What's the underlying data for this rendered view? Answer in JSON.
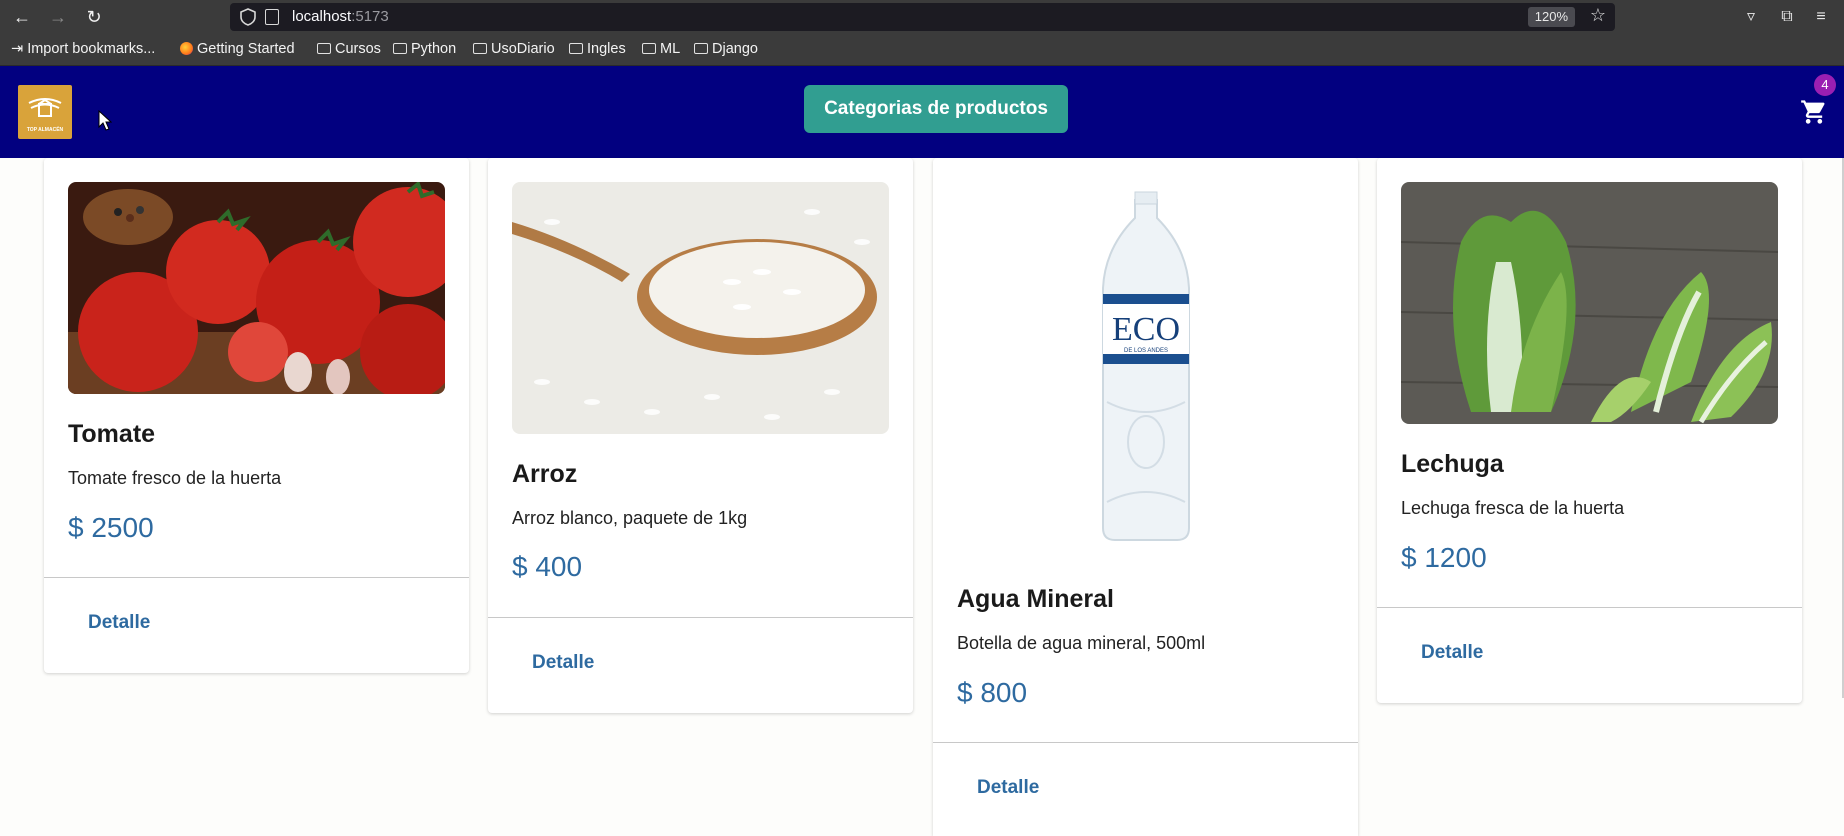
{
  "browser": {
    "url_host": "localhost",
    "url_port": ":5173",
    "zoom": "120%",
    "bookmarks": [
      {
        "label": "Import bookmarks...",
        "icon": "import-icon"
      },
      {
        "label": "Getting Started",
        "icon": "firefox-icon"
      },
      {
        "label": "Cursos",
        "icon": "folder-icon"
      },
      {
        "label": "Python",
        "icon": "folder-icon"
      },
      {
        "label": "UsoDiario",
        "icon": "folder-icon"
      },
      {
        "label": "Ingles",
        "icon": "folder-icon"
      },
      {
        "label": "ML",
        "icon": "folder-icon"
      },
      {
        "label": "Django",
        "icon": "folder-icon"
      }
    ]
  },
  "navbar": {
    "logo_text": "TOP ALMACÉN",
    "categories_label": "Categorias de productos",
    "cart_count": "4",
    "bg_color": "#020080",
    "button_color": "#319e91"
  },
  "products": [
    {
      "name": "Tomate",
      "description": "Tomate fresco de la huerta",
      "price": "$ 2500",
      "detail_label": "Detalle",
      "image": "tomato-image"
    },
    {
      "name": "Arroz",
      "description": "Arroz blanco, paquete de 1kg",
      "price": "$ 400",
      "detail_label": "Detalle",
      "image": "rice-image"
    },
    {
      "name": "Agua Mineral",
      "description": "Botella de agua mineral, 500ml",
      "price": "$ 800",
      "detail_label": "Detalle",
      "image": "water-bottle-image",
      "bottle_brand": "ECO",
      "bottle_subbrand": "DE LOS ANDES"
    },
    {
      "name": "Lechuga",
      "description": "Lechuga fresca de la huerta",
      "price": "$ 1200",
      "detail_label": "Detalle",
      "image": "lettuce-image"
    }
  ]
}
